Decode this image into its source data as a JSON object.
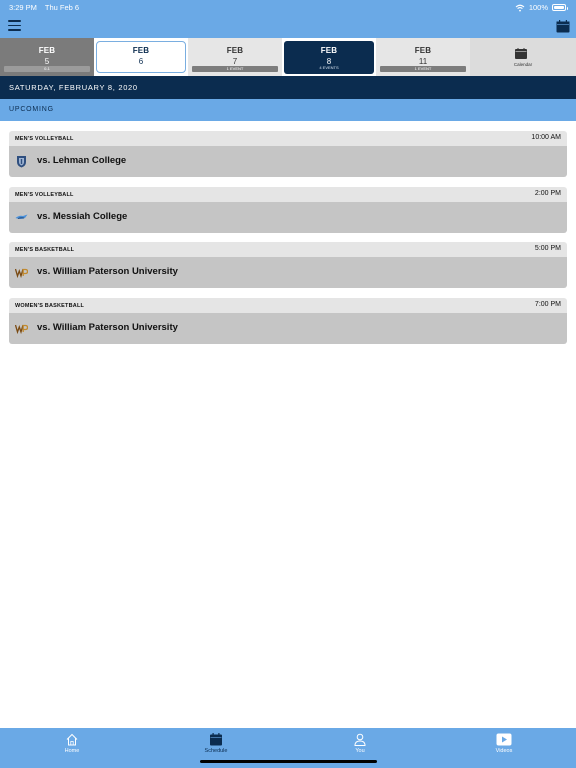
{
  "status_bar": {
    "time": "3:29 PM",
    "date": "Thu Feb 6",
    "battery": "100%"
  },
  "date_strip": [
    {
      "month": "FEB",
      "day": "5",
      "badge": "0-1",
      "state": "past"
    },
    {
      "month": "FEB",
      "day": "6",
      "badge": "",
      "state": "today"
    },
    {
      "month": "FEB",
      "day": "7",
      "badge": "1 EVENT",
      "state": "normal"
    },
    {
      "month": "FEB",
      "day": "8",
      "badge": "4 EVENTS",
      "state": "selected"
    },
    {
      "month": "FEB",
      "day": "11",
      "badge": "1 EVENT",
      "state": "normal"
    }
  ],
  "calendar_button": {
    "label": "Calendar"
  },
  "selected_date_header": "SATURDAY, FEBRUARY 8, 2020",
  "section_label": "UPCOMING",
  "events": [
    {
      "sport": "MEN'S VOLLEYBALL",
      "time": "10:00 AM",
      "opponent": "vs. Lehman College",
      "logo": "lehman-logo"
    },
    {
      "sport": "MEN'S VOLLEYBALL",
      "time": "2:00 PM",
      "opponent": "vs. Messiah College",
      "logo": "messiah-logo"
    },
    {
      "sport": "MEN'S BASKETBALL",
      "time": "5:00 PM",
      "opponent": "vs. William Paterson University",
      "logo": "wp-logo"
    },
    {
      "sport": "WOMEN'S BASKETBALL",
      "time": "7:00 PM",
      "opponent": "vs. William Paterson University",
      "logo": "wp-logo"
    }
  ],
  "tabs": [
    {
      "label": "Home",
      "icon": "home-icon",
      "active": false
    },
    {
      "label": "Schedule",
      "icon": "calendar-icon",
      "active": true
    },
    {
      "label": "You",
      "icon": "person-icon",
      "active": false
    },
    {
      "label": "Videos",
      "icon": "play-icon",
      "active": false
    }
  ],
  "colors": {
    "accent": "#6aa9e6",
    "navy": "#0b2c4f",
    "past_cell": "#7b7b7b",
    "event_header": "#e5e5e5",
    "event_body": "#c5c5c5"
  }
}
